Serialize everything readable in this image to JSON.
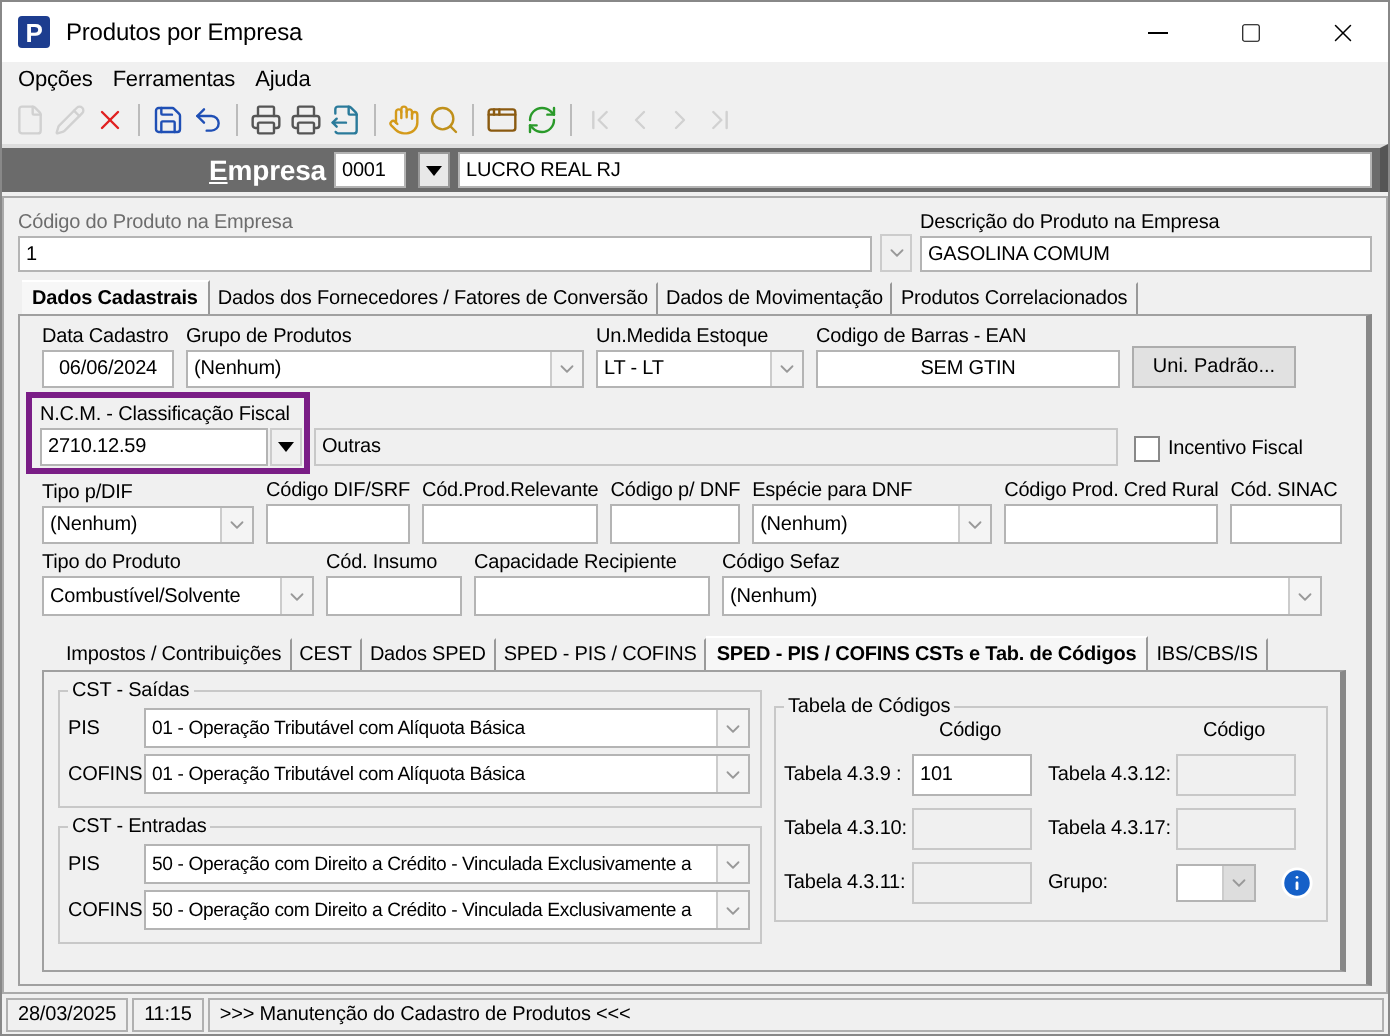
{
  "window": {
    "title": "Produtos por Empresa",
    "icon_letter": "P"
  },
  "menu": [
    "Opções",
    "Ferramentas",
    "Ajuda"
  ],
  "toolbar": [
    {
      "kind": "new",
      "disabled": true
    },
    {
      "kind": "edit",
      "disabled": true
    },
    {
      "kind": "delete",
      "disabled": false
    },
    {
      "kind": "separator"
    },
    {
      "kind": "save",
      "disabled": false
    },
    {
      "kind": "undo",
      "disabled": false
    },
    {
      "kind": "separator"
    },
    {
      "kind": "print",
      "disabled": false
    },
    {
      "kind": "print",
      "disabled": false
    },
    {
      "kind": "export",
      "disabled": false
    },
    {
      "kind": "separator"
    },
    {
      "kind": "hand",
      "disabled": false
    },
    {
      "kind": "search",
      "disabled": false
    },
    {
      "kind": "separator"
    },
    {
      "kind": "window",
      "disabled": false
    },
    {
      "kind": "refresh",
      "disabled": false
    },
    {
      "kind": "separator"
    },
    {
      "kind": "first",
      "disabled": true
    },
    {
      "kind": "prev",
      "disabled": true
    },
    {
      "kind": "next",
      "disabled": true
    },
    {
      "kind": "last",
      "disabled": true
    }
  ],
  "empresa": {
    "label": "Empresa",
    "code": "0001",
    "name": "LUCRO REAL RJ"
  },
  "product": {
    "code_label": "Código do Produto na Empresa",
    "code": "1",
    "description_label": "Descrição do Produto na Empresa",
    "description": "GASOLINA COMUM"
  },
  "tabs": [
    {
      "label": "Dados Cadastrais",
      "selected": true
    },
    {
      "label": "Dados dos Fornecedores / Fatores de Conversão",
      "selected": false
    },
    {
      "label": "Dados de Movimentação",
      "selected": false
    },
    {
      "label": "Produtos Correlacionados",
      "selected": false
    }
  ],
  "general": {
    "data_cadastro": {
      "label": "Data Cadastro",
      "value": "06/06/2024"
    },
    "grupo": {
      "label": "Grupo de Produtos",
      "value": "(Nenhum)"
    },
    "un_medida": {
      "label": "Un.Medida Estoque",
      "value": "LT - LT"
    },
    "ean": {
      "label": "Codigo de Barras - EAN",
      "value": "SEM GTIN"
    },
    "uni_button": "Uni. Padrão...",
    "ncm": {
      "label": "N.C.M. -  Classificação Fiscal",
      "value": "2710.12.59",
      "description": "Outras",
      "highlighted": true
    },
    "incentivo": {
      "label": "Incentivo Fiscal",
      "checked": false
    },
    "tipo_dif": {
      "label": "Tipo p/DIF",
      "value": "(Nenhum)"
    },
    "codigo_dif": {
      "label": "Código DIF/SRF"
    },
    "cod_prod_relevante": {
      "label": "Cód.Prod.Relevante"
    },
    "codigo_dnf": {
      "label": "Código p/ DNF"
    },
    "especie_dnf": {
      "label": "Espécie para DNF",
      "value": "(Nenhum)"
    },
    "cred_rural": {
      "label": "Código Prod. Cred Rural"
    },
    "sinac": {
      "label": "Cód. SINAC"
    },
    "tipo_produto": {
      "label": "Tipo do Produto",
      "value": "Combustível/Solvente"
    },
    "insumo": {
      "label": "Cód. Insumo"
    },
    "capacidade": {
      "label": "Capacidade Recipiente"
    },
    "sefaz": {
      "label": "Código Sefaz",
      "value": "(Nenhum)"
    }
  },
  "subtabs": [
    {
      "label": "Impostos / Contribuições",
      "selected": false
    },
    {
      "label": "CEST",
      "selected": false
    },
    {
      "label": "Dados SPED",
      "selected": false
    },
    {
      "label": "SPED - PIS / COFINS",
      "selected": false
    },
    {
      "label": "SPED - PIS / COFINS CSTs e Tab. de Códigos",
      "selected": true
    },
    {
      "label": "IBS/CBS/IS",
      "selected": false
    }
  ],
  "cst_groups": [
    {
      "title": "CST - Saídas",
      "rows": [
        {
          "label": "PIS",
          "value": "01 - Operação Tributável com Alíquota Básica"
        },
        {
          "label": "COFINS",
          "value": "01 - Operação Tributável com Alíquota Básica"
        }
      ]
    },
    {
      "title": "CST - Entradas",
      "rows": [
        {
          "label": "PIS",
          "value": "50 - Operação com Direito a Crédito - Vinculada Exclusivamente a"
        },
        {
          "label": "COFINS",
          "value": "50 - Operação com Direito a Crédito - Vinculada Exclusivamente a"
        }
      ]
    }
  ],
  "tabela": {
    "title": "Tabela de Códigos",
    "headers": [
      "Código",
      "Código"
    ],
    "items": [
      {
        "kind": "text",
        "label": "Tabela 4.3.9 :",
        "value": "101",
        "disabled": false
      },
      {
        "kind": "text",
        "label": "Tabela 4.3.12:",
        "disabled": true
      },
      {
        "kind": "text",
        "label": "Tabela 4.3.10:",
        "disabled": true
      },
      {
        "kind": "text",
        "label": "Tabela 4.3.17:",
        "disabled": true
      },
      {
        "kind": "text",
        "label": "Tabela 4.3.11:",
        "disabled": true
      },
      {
        "kind": "combo",
        "label": "Grupo:",
        "disabled": false
      }
    ]
  },
  "status_bar": [
    "28/03/2025",
    "11:15",
    ">>> Manutenção do Cadastro de Produtos <<<"
  ]
}
